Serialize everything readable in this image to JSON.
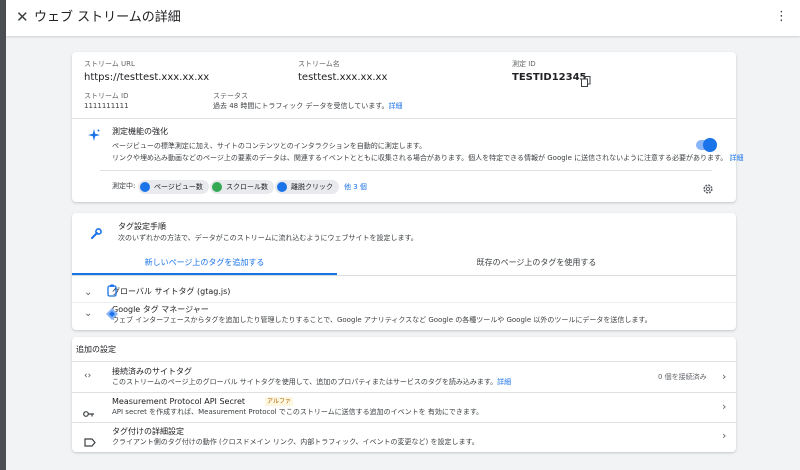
{
  "header": {
    "title": "ウェブ ストリームの詳細"
  },
  "stream": {
    "url_label": "ストリーム URL",
    "url_value": "https://testtest.xxx.xx.xx",
    "name_label": "ストリーム名",
    "name_value": "testtest.xxx.xx.xx",
    "measurement_id_label": "測定 ID",
    "measurement_id_value": "TESTID12345",
    "stream_id_label": "ストリーム ID",
    "stream_id_value": "1111111111",
    "status_label": "ステータス",
    "status_value": "過去 48 時間にトラフィック データを受信しています。",
    "status_link": "詳細"
  },
  "enhanced": {
    "title": "測定機能の強化",
    "desc_line1": "ページビューの標準測定に加え、サイトのコンテンツとのインタラクションを自動的に測定します。",
    "desc_line2": "リンクや埋め込み動画などのページ上の要素のデータは、関連するイベントとともに収集される場合があります。個人を特定できる情報が Google に送信されないように注意する必要があります。",
    "desc_link": "詳細",
    "toggle_on": true,
    "measuring_label": "測定中:",
    "chips": [
      "ページビュー数",
      "スクロール数",
      "離脱クリック"
    ],
    "more_link": "他 3 個",
    "colors": {
      "accent": "#1a73e8",
      "chip_blue": "#1a73e8",
      "chip_green": "#34a853"
    }
  },
  "tag": {
    "title": "タグ設定手順",
    "subtitle": "次のいずれかの方法で、データがこのストリームに流れ込むようにウェブサイトを設定します。",
    "tab_new": "新しいページ上のタグを追加する",
    "tab_existing": "既存のページ上のタグを使用する",
    "items": [
      {
        "title": "グローバル サイトタグ (gtag.js)",
        "desc": ""
      },
      {
        "title": "Google タグ マネージャー",
        "desc": "ウェブ インターフェースからタグを追加したり管理したりすることで、Google アナリティクスなど Google の各種ツールや Google 以外のツールにデータを送信します。"
      }
    ]
  },
  "additional": {
    "header": "追加の設定",
    "rows": [
      {
        "title": "接続済みのサイトタグ",
        "desc": "このストリームのページ上のグローバル サイトタグを使用して、追加のプロパティまたはサービスのタグを読み込みます。",
        "link": "詳細",
        "meta": "0 個を接続済み"
      },
      {
        "title": "Measurement Protocol API Secret",
        "badge": "アルファ",
        "desc": "API secret を作成すれば、Measurement Protocol でこのストリームに送信する追加のイベントを 有効にできます。"
      },
      {
        "title": "タグ付けの詳細設定",
        "desc": "クライアント側のタグ付けの動作 (クロスドメイン リンク、内部トラフィック、イベントの変更など) を設定します。"
      }
    ]
  }
}
